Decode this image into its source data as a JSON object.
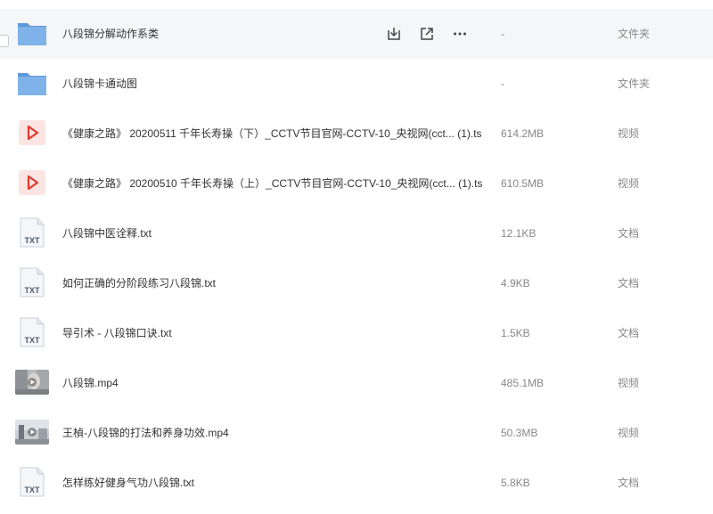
{
  "colors": {
    "folder": "#6fa6e0",
    "video_play": "#e0392f",
    "text_secondary": "#888888",
    "row_hover": "#f5f6f8"
  },
  "files": [
    {
      "name": "八段锦分解动作系类",
      "size": "-",
      "type": "文件夹",
      "icon": "folder-icon"
    },
    {
      "name": "八段锦卡通动图",
      "size": "-",
      "type": "文件夹",
      "icon": "folder-icon"
    },
    {
      "name": "《健康之路》 20200511 千年长寿操（下）_CCTV节目官网-CCTV-10_央视网(cct... (1).ts",
      "size": "614.2MB",
      "type": "视频",
      "icon": "video-file-icon"
    },
    {
      "name": "《健康之路》 20200510 千年长寿操（上）_CCTV节目官网-CCTV-10_央视网(cct... (1).ts",
      "size": "610.5MB",
      "type": "视频",
      "icon": "video-file-icon"
    },
    {
      "name": "八段锦中医诠释.txt",
      "size": "12.1KB",
      "type": "文档",
      "icon": "txt-file-icon",
      "badge": "TXT"
    },
    {
      "name": "如何正确的分阶段练习八段锦.txt",
      "size": "4.9KB",
      "type": "文档",
      "icon": "txt-file-icon",
      "badge": "TXT"
    },
    {
      "name": "导引术 - 八段锦口诀.txt",
      "size": "1.5KB",
      "type": "文档",
      "icon": "txt-file-icon",
      "badge": "TXT"
    },
    {
      "name": "八段锦.mp4",
      "size": "485.1MB",
      "type": "视频",
      "icon": "video-thumbnail"
    },
    {
      "name": "王楨-八段锦的打法和养身功效.mp4",
      "size": "50.3MB",
      "type": "视频",
      "icon": "video-thumbnail"
    },
    {
      "name": "怎样练好健身气功八段锦.txt",
      "size": "5.8KB",
      "type": "文档",
      "icon": "txt-file-icon",
      "badge": "TXT"
    }
  ],
  "row_actions": [
    "download-icon",
    "share-icon",
    "more-icon"
  ]
}
